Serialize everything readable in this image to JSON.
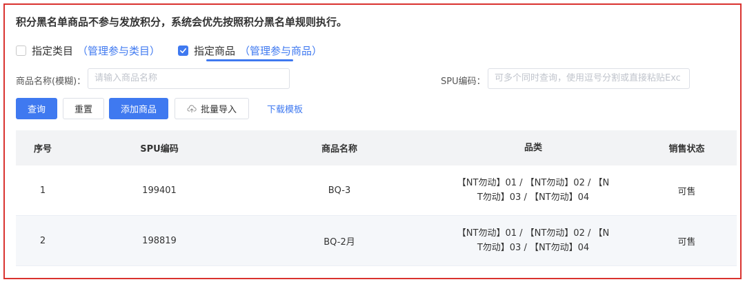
{
  "notice": "积分黑名单商品不参与发放积分，系统会优先按照积分黑名单规则执行。",
  "scope": {
    "category": {
      "label": "指定类目",
      "link": "（管理参与类目）",
      "checked": false
    },
    "product": {
      "label": "指定商品",
      "link": "（管理参与商品）",
      "checked": true
    }
  },
  "filters": {
    "name_label": "商品名称(模糊)：",
    "name_placeholder": "请输入商品名称",
    "spu_label": "SPU编码：",
    "spu_placeholder": "可多个同时查询，使用逗号分割或直接粘贴Exc"
  },
  "actions": {
    "query": "查询",
    "reset": "重置",
    "add": "添加商品",
    "import": "批量导入",
    "template": "下载模板"
  },
  "table": {
    "headers": [
      "序号",
      "SPU编码",
      "商品名称",
      "品类",
      "销售状态"
    ],
    "rows": [
      {
        "no": "1",
        "spu": "199401",
        "name": "BQ-3",
        "cat1": "【NT勿动】01 / 【NT勿动】02 / 【N",
        "cat2": "T勿动】03 / 【NT勿动】04",
        "status": "可售"
      },
      {
        "no": "2",
        "spu": "198819",
        "name": "BQ-2月",
        "cat1": "【NT勿动】01 / 【NT勿动】02 / 【N",
        "cat2": "T勿动】03 / 【NT勿动】04",
        "status": "可售"
      }
    ]
  },
  "colors": {
    "primary": "#3f79f0",
    "frame": "#d9322e"
  }
}
